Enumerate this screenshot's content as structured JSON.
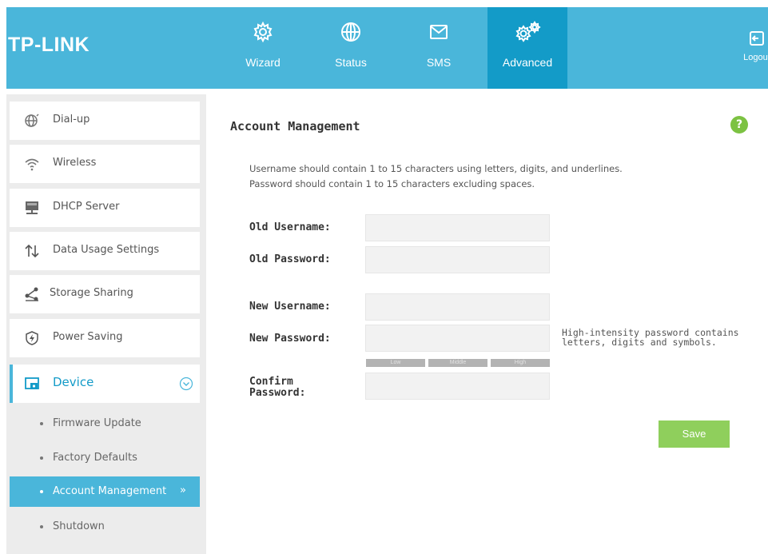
{
  "header": {
    "logo": "TP-LINK",
    "nav": [
      {
        "label": "Wizard",
        "icon": "gear-icon"
      },
      {
        "label": "Status",
        "icon": "globe-icon"
      },
      {
        "label": "SMS",
        "icon": "envelope-icon"
      },
      {
        "label": "Advanced",
        "icon": "gears-icon",
        "active": true
      }
    ],
    "logout_label": "Logout"
  },
  "sidebar": {
    "items": [
      {
        "label": "Dial-up",
        "icon": "dialup-globe-icon"
      },
      {
        "label": "Wireless",
        "icon": "wifi-icon"
      },
      {
        "label": "DHCP Server",
        "icon": "server-icon"
      },
      {
        "label": "Data Usage Settings",
        "icon": "updown-arrows-icon"
      },
      {
        "label": "Storage Sharing",
        "icon": "share-icon"
      },
      {
        "label": "Power Saving",
        "icon": "power-shield-icon"
      },
      {
        "label": "Device",
        "icon": "device-icon",
        "expanded": true
      }
    ],
    "sub_items": [
      {
        "label": "Firmware Update"
      },
      {
        "label": "Factory Defaults"
      },
      {
        "label": "Account Management",
        "active": true
      },
      {
        "label": "Shutdown"
      }
    ],
    "active_arrow": "»"
  },
  "main": {
    "title": "Account Management",
    "help": "?",
    "hint_line1": "Username should contain 1 to 15 characters using letters, digits, and underlines.",
    "hint_line2": "Password should contain 1 to 15 characters excluding spaces.",
    "fields": {
      "old_username_label": "Old Username:",
      "old_password_label": "Old Password:",
      "new_username_label": "New Username:",
      "new_password_label": "New Password:",
      "confirm_label_1": "Confirm",
      "confirm_label_2": "Password:",
      "old_username_value": "",
      "old_password_value": "",
      "new_username_value": "",
      "new_password_value": "",
      "confirm_password_value": ""
    },
    "strength": {
      "low": "Low",
      "middle": "Middle",
      "high": "High"
    },
    "tip_line1": "High-intensity password contains",
    "tip_line2": "letters, digits and symbols.",
    "save_label": "Save"
  },
  "colors": {
    "header_bg": "#4ab6da",
    "active_nav_bg": "#139bc8",
    "save_button": "#8fcf5c",
    "help_icon": "#7cc242"
  }
}
